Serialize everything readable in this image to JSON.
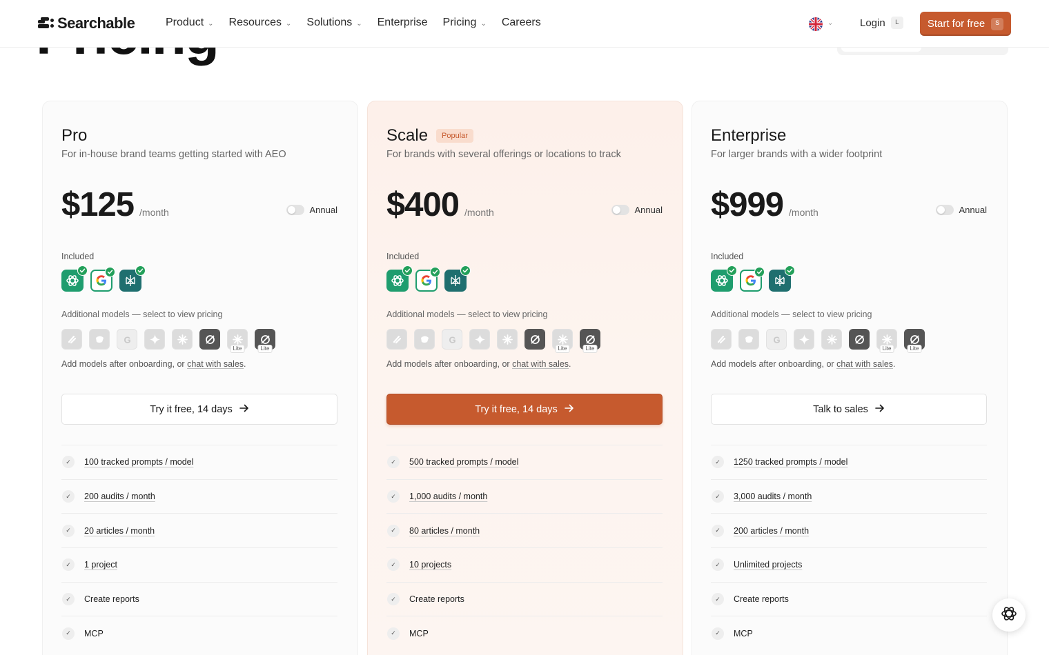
{
  "header": {
    "logo_text": "Searchable",
    "nav": [
      {
        "label": "Product",
        "dropdown": true
      },
      {
        "label": "Resources",
        "dropdown": true
      },
      {
        "label": "Solutions",
        "dropdown": true
      },
      {
        "label": "Enterprise",
        "dropdown": false
      },
      {
        "label": "Pricing",
        "dropdown": true
      },
      {
        "label": "Careers",
        "dropdown": false
      }
    ],
    "login_label": "Login",
    "login_shortcut": "L",
    "cta_label": "Start for free",
    "cta_shortcut": "S"
  },
  "page_title": "Pricing",
  "common": {
    "annual_label": "Annual",
    "included_label": "Included",
    "additional_label": "Additional models — select to view pricing",
    "note_prefix": "Add models after onboarding, or ",
    "note_link": "chat with sales",
    "note_suffix": ".",
    "lite_label": "Lite"
  },
  "plans": [
    {
      "name": "Pro",
      "badge": "",
      "description": "For in-house brand teams getting started with AEO",
      "price": "$125",
      "period": "/month",
      "cta": "Try it free, 14 days",
      "features": [
        {
          "text": "100 tracked prompts / model",
          "underline": true
        },
        {
          "text": "200 audits / month",
          "underline": true
        },
        {
          "text": "20 articles / month",
          "underline": true
        },
        {
          "text": "1 project",
          "underline": true
        },
        {
          "text": "Create reports",
          "underline": false
        },
        {
          "text": "MCP",
          "underline": false
        }
      ]
    },
    {
      "name": "Scale",
      "badge": "Popular",
      "description": "For brands with several offerings or locations to track",
      "price": "$400",
      "period": "/month",
      "cta": "Try it free, 14 days",
      "features": [
        {
          "text": "500 tracked prompts / model",
          "underline": true
        },
        {
          "text": "1,000 audits / month",
          "underline": true
        },
        {
          "text": "80 articles / month",
          "underline": true
        },
        {
          "text": "10 projects",
          "underline": true
        },
        {
          "text": "Create reports",
          "underline": false
        },
        {
          "text": "MCP",
          "underline": false
        }
      ]
    },
    {
      "name": "Enterprise",
      "badge": "",
      "description": "For larger brands with a wider footprint",
      "price": "$999",
      "period": "/month",
      "cta": "Talk to sales",
      "features": [
        {
          "text": "1250 tracked prompts / model",
          "underline": true
        },
        {
          "text": "3,000 audits / month",
          "underline": true
        },
        {
          "text": "200 articles / month",
          "underline": true
        },
        {
          "text": "Unlimited projects",
          "underline": true
        },
        {
          "text": "Create reports",
          "underline": false
        },
        {
          "text": "MCP",
          "underline": false
        }
      ]
    }
  ],
  "icons": {
    "included": [
      "chatgpt-icon",
      "google-ai-icon",
      "perplexity-icon"
    ],
    "additional": [
      "claude-icon",
      "copilot-icon",
      "gemini-icon",
      "ai-mode-icon",
      "meta-ai-icon",
      "grok-icon",
      "meta-lite-icon",
      "grok-lite-icon"
    ]
  },
  "colors": {
    "accent": "#c65a2e",
    "check_green": "#23a05a",
    "chatgpt_green": "#1f9d6e"
  }
}
